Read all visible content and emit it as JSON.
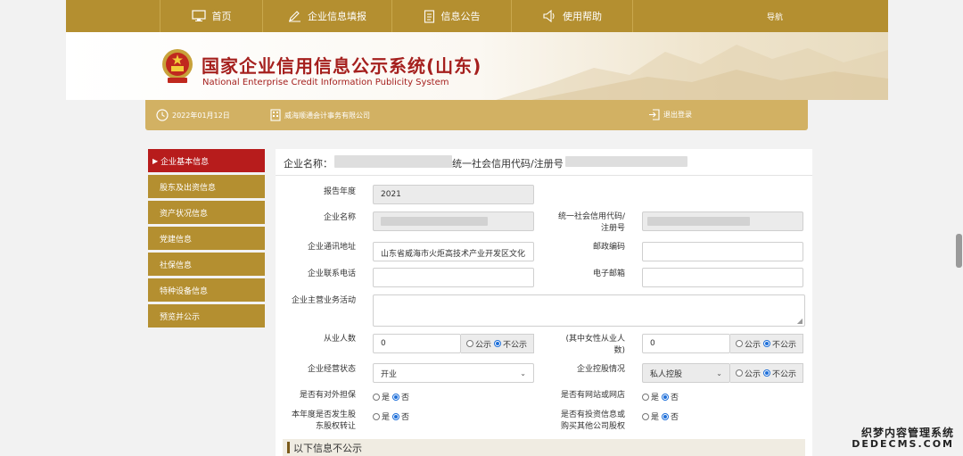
{
  "nav": {
    "items": [
      {
        "label": "首页",
        "icon": "monitor-icon"
      },
      {
        "label": "企业信息填报",
        "icon": "pen-icon"
      },
      {
        "label": "信息公告",
        "icon": "document-icon"
      },
      {
        "label": "使用帮助",
        "icon": "speaker-icon"
      }
    ],
    "right_label": "导航"
  },
  "header": {
    "title_cn": "国家企业信用信息公示系统(山东)",
    "title_en": "National Enterprise Credit Information Publicity System"
  },
  "infobar": {
    "date": "2022年01月12日",
    "company": "威海顺通会计事务有限公司",
    "logout": "退出登录"
  },
  "sidebar": {
    "items": [
      {
        "label": "企业基本信息",
        "active": true
      },
      {
        "label": "股东及出资信息"
      },
      {
        "label": "资产状况信息"
      },
      {
        "label": "党建信息"
      },
      {
        "label": "社保信息"
      },
      {
        "label": "特种设备信息"
      },
      {
        "label": "预览并公示"
      }
    ]
  },
  "main": {
    "company_name_label": "企业名称：",
    "credit_code_label": "统一社会信用代码/注册号",
    "section_title": "以下信息不公示"
  },
  "form": {
    "report_year": {
      "label": "报告年度",
      "value": "2021"
    },
    "company_name": {
      "label": "企业名称"
    },
    "credit_code": {
      "label1": "统一社会信用代码/",
      "label2": "注册号"
    },
    "address": {
      "label": "企业通讯地址",
      "value": "山东省威海市火炬高技术产业开发区文化"
    },
    "postcode": {
      "label": "邮政编码",
      "value": ""
    },
    "phone": {
      "label": "企业联系电话",
      "value": ""
    },
    "email": {
      "label": "电子邮箱",
      "value": ""
    },
    "business": {
      "label": "企业主营业务活动"
    },
    "employees": {
      "label": "从业人数",
      "value": "0"
    },
    "female_employees": {
      "label1": "(其中女性从业人",
      "label2": "数)",
      "value": "0"
    },
    "status": {
      "label": "企业经营状态",
      "value": "开业"
    },
    "holding": {
      "label": "企业控股情况",
      "value": "私人控股"
    },
    "guarantee": {
      "label": "是否有对外担保"
    },
    "website": {
      "label": "是否有网站或网店"
    },
    "equity_transfer": {
      "label1": "本年度是否发生股",
      "label2": "东股权转让"
    },
    "investment": {
      "label1": "是否有投资信息或",
      "label2": "购买其他公司股权"
    },
    "radio": {
      "public": "公示",
      "not_public": "不公示",
      "yes": "是",
      "no": "否"
    }
  },
  "watermark": {
    "line1": "织梦内容管理系统",
    "line2": "DEDECMS.COM"
  },
  "colors": {
    "nav_gold": "#b48f30",
    "banner_gold": "#d2b163",
    "active_red": "#b71c1c",
    "title_red": "#a5201e",
    "radio_blue": "#1e6fd9"
  }
}
